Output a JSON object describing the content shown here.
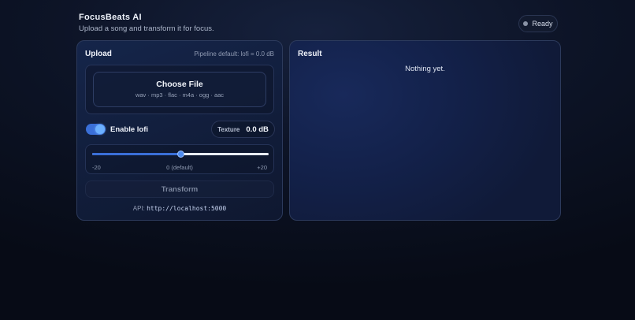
{
  "app": {
    "title": "FocusBeats AI",
    "subtitle": "Upload a song and transform it for focus."
  },
  "status": {
    "label": "Ready",
    "dot_color": "#8a93a6"
  },
  "upload": {
    "title": "Upload",
    "pipeline_note": "Pipeline default: lofi = 0.0 dB",
    "dropzone": {
      "label": "Choose File",
      "formats": "wav · mp3 · flac · m4a · ogg · aac"
    },
    "lofi_toggle": {
      "label": "Enable lofi",
      "enabled": true
    },
    "texture": {
      "label": "Texture",
      "value": "0.0 dB"
    },
    "slider": {
      "min_label": "-20",
      "mid_label": "0 (default)",
      "max_label": "+20",
      "min": -20,
      "max": 20,
      "value": 0
    },
    "transform_label": "Transform",
    "api": {
      "prefix": "API:",
      "url": "http://localhost:5000"
    }
  },
  "result": {
    "title": "Result",
    "empty_text": "Nothing yet."
  },
  "colors": {
    "accent": "#3a6fd8",
    "background": "#0d1427"
  }
}
